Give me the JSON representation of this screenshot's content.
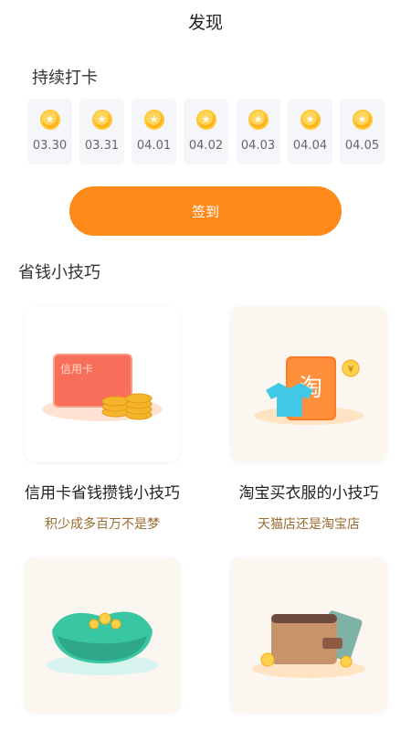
{
  "header": {
    "title": "发现"
  },
  "checkin": {
    "title": "持续打卡",
    "days": [
      "03.30",
      "03.31",
      "04.01",
      "04.02",
      "04.03",
      "04.04",
      "04.05"
    ],
    "button_label": "签到"
  },
  "tips": {
    "title": "省钱小技巧",
    "cards": [
      {
        "title": "信用卡省钱攒钱小技巧",
        "subtitle": "积少成多百万不是梦",
        "image_text": "信用卡",
        "icon": "credit-card-coins-icon"
      },
      {
        "title": "淘宝买衣服的小技巧",
        "subtitle": "天猫店还是淘宝店",
        "image_text": "淘",
        "icon": "taobao-bag-icon"
      },
      {
        "title": "",
        "subtitle": "",
        "icon": "money-bowl-icon"
      },
      {
        "title": "",
        "subtitle": "",
        "icon": "wallet-icon"
      }
    ]
  },
  "colors": {
    "accent": "#ff8a1a",
    "subtitle": "#9a6b2f",
    "day_bg": "#f4f6fa"
  }
}
